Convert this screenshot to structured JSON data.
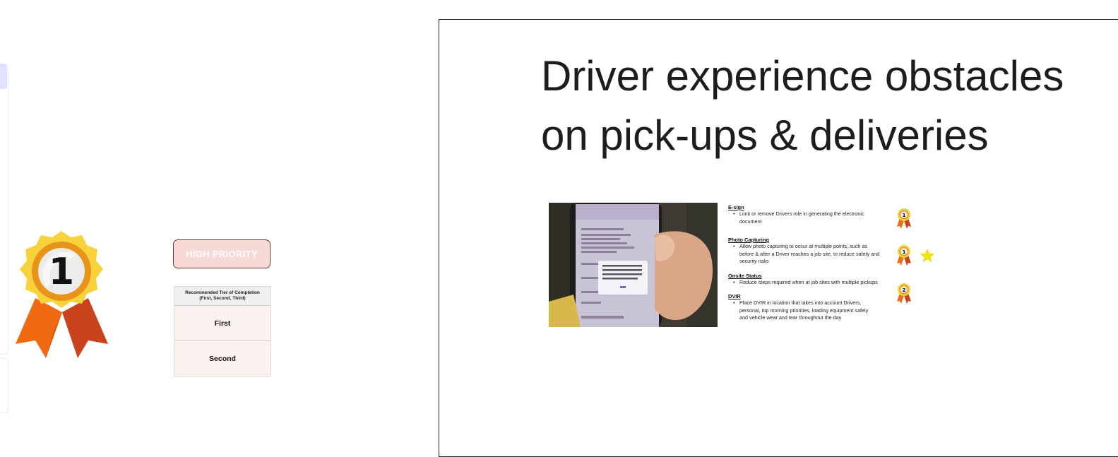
{
  "left_panel": {
    "priority_label": "HIGH PRIORITY",
    "award_rank": "1",
    "tier_table": {
      "header": [
        "Recommended Tier of Completion",
        "(First, Second, Third)"
      ],
      "rows": [
        "First",
        "Second"
      ]
    }
  },
  "slide": {
    "title_line1": "Driver experience obstacles",
    "title_line2": "on pick-ups & deliveries",
    "photo_alt": "Phone showing electronic signature notice in driver's hand",
    "items": [
      {
        "heading": "E-sign",
        "bullet": "Limit or remove Drivers role in generating the electronic document",
        "bullet_lines": [
          "Limit or remove Drivers role in generating the electronic",
          "document"
        ],
        "medal": "1",
        "starred": false
      },
      {
        "heading": "Photo Capturing",
        "bullet": "Allow photo capturing to occur at multiple points, such as before & after a Driver reaches a job site, to reduce safety and security risks",
        "bullet_lines": [
          "Allow photo capturing to occur at multiple points, such as",
          "before & after a Driver reaches a job site, to reduce safety and",
          "security risks"
        ],
        "medal": "1",
        "starred": true
      },
      {
        "heading": "Onsite Status",
        "bullet": "Reduce steps required when at job sites with multiple pickups",
        "bullet_lines": [
          "Reduce steps required when at job sites with multiple pickups"
        ],
        "medal": "2",
        "starred": false
      },
      {
        "heading": "DVIR",
        "bullet": "Place DVIR in location that takes into account Drivers, personal, top morning priorities, loading equipment safely and vehicle wear and tear throughout the day",
        "bullet_lines": [
          "Place DVIR in location that takes into account Drivers,",
          "personal, top morning priorities, loading equipment safely",
          "and vehicle wear and tear throughout the day"
        ],
        "medal": "",
        "starred": false
      }
    ]
  },
  "colors": {
    "priority_fill": "#f9d9d6",
    "priority_border": "#6b3b36",
    "medal_gold": "#f5c518",
    "ribbon_orange": "#e85d10",
    "star_yellow": "#f2e600"
  }
}
